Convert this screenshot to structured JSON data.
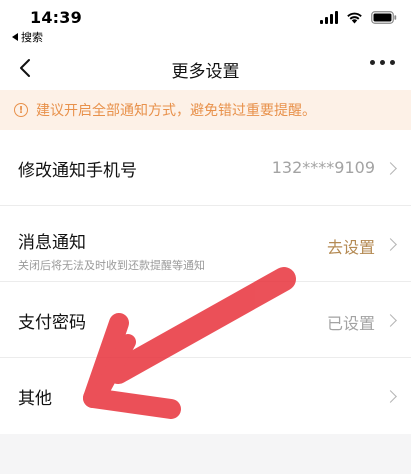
{
  "status_bar": {
    "time": "14:39",
    "back_app_label": "搜索"
  },
  "nav": {
    "title": "更多设置"
  },
  "notice": {
    "icon_text": "!",
    "text": "建议开启全部通知方式，避免错过重要提醒。",
    "color": "#e8914b"
  },
  "settings": {
    "items": [
      {
        "label": "修改通知手机号",
        "value": "132****9109",
        "subtitle": ""
      },
      {
        "label": "消息通知",
        "value": "去设置",
        "subtitle": "关闭后将无法及时收到还款提醒等通知"
      },
      {
        "label": "支付密码",
        "value": "已设置",
        "subtitle": ""
      },
      {
        "label": "其他",
        "value": "",
        "subtitle": ""
      }
    ]
  },
  "annotation": {
    "color": "#e8323c"
  }
}
